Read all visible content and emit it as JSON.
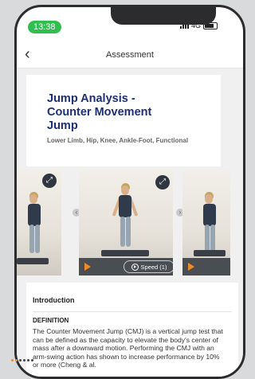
{
  "status_bar": {
    "time": "13:38",
    "network": "4G"
  },
  "nav": {
    "title": "Assessment"
  },
  "assessment": {
    "title": "Jump Analysis - Counter Movement Jump",
    "tags": "Lower Limb, Hip, Knee, Ankle-Foot, Functional"
  },
  "video": {
    "speed_label": "Speed (1)"
  },
  "introduction": {
    "heading": "Introduction",
    "definition_label": "DEFINITION",
    "definition_text": "The Counter Movement Jump (CMJ) is a vertical jump test that can be defined as the capacity to elevate the body's center of mass after a downward motion. Performing the CMJ with an arm-swing action has shown to increase performance by 10% or more (Cheng & al."
  },
  "colors": {
    "accent": "#f08a24",
    "title": "#1d2f73",
    "time_pill": "#2fbf4f"
  }
}
